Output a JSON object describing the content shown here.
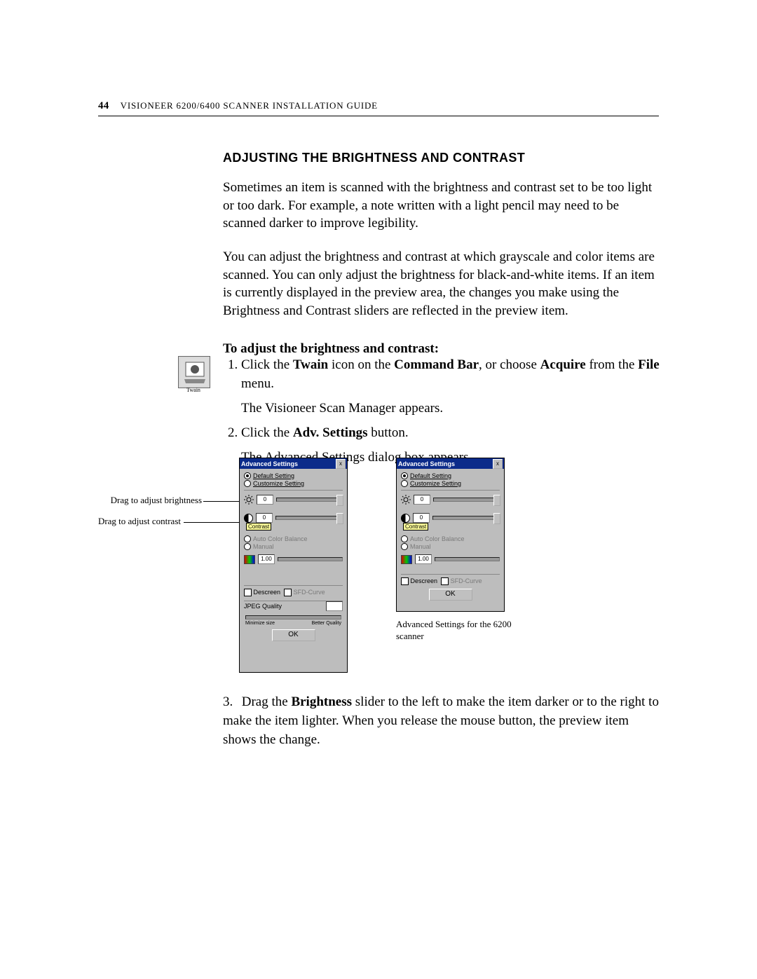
{
  "header": {
    "page_number": "44",
    "doc_title": "Visioneer 6200/6400 Scanner Installation Guide"
  },
  "section_title": "Adjusting the Brightness and Contrast",
  "paragraphs": {
    "p1": "Sometimes an item is scanned with the brightness and contrast set to be too light or too dark. For example, a note written with a light pencil may need to be scanned darker to improve legibility.",
    "p2": "You can adjust the brightness and contrast at which grayscale and color items are scanned. You can only adjust the brightness for black-and-white items. If an item is currently displayed in the preview area, the changes you make using the Brightness and Contrast sliders are reflected in the preview item."
  },
  "instruction_heading": "To adjust the brightness and contrast:",
  "steps": {
    "s1a": "Click the ",
    "s1_twain": "Twain",
    "s1b": " icon on the ",
    "s1_cmdbar": "Command Bar",
    "s1c": ", or choose ",
    "s1_acquire": "Acquire",
    "s1d": " from the ",
    "s1_file": "File",
    "s1e": " menu.",
    "s1_result": "The Visioneer Scan Manager appears.",
    "s2a": "Click the ",
    "s2_adv": "Adv. Settings",
    "s2b": " button.",
    "s2_result": "The Advanced Settings dialog box appears.",
    "s3a": "Drag the ",
    "s3_bright": "Brightness",
    "s3b": " slider to the left to make the item darker or to the right to make the item lighter. When you release the mouse button, the preview item shows the change."
  },
  "twain_label": "Twain",
  "callouts": {
    "brightness": "Drag to adjust brightness",
    "contrast": "Drag to adjust contrast"
  },
  "dialog": {
    "title": "Advanced Settings",
    "close": "x",
    "default_setting": "Default Setting",
    "customize_setting": "Customize Setting",
    "contrast_label": "Contrast",
    "auto_color": "Auto Color Balance",
    "manual": "Manual",
    "descreen": "Descreen",
    "sfd": "SFD-Curve",
    "jpeg_quality": "JPEG Quality",
    "min_size": "Minimize size",
    "better_quality": "Better Quality",
    "ok": "OK",
    "val0": "0",
    "val100": "1.00"
  },
  "caption": "Advanced Settings for the 6200 scanner"
}
